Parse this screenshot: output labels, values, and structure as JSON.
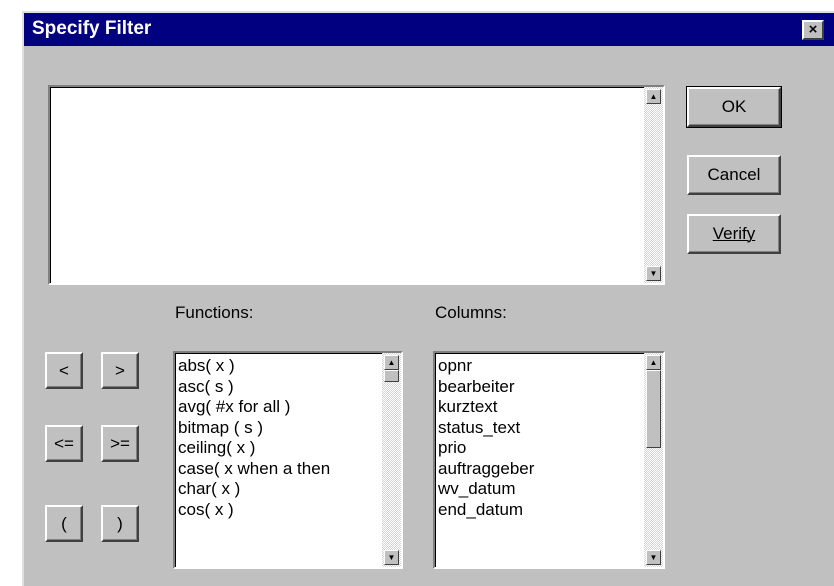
{
  "dialog": {
    "title": "Specify Filter",
    "close_label": "×"
  },
  "expression": {
    "value": ""
  },
  "buttons": {
    "ok": "OK",
    "cancel": "Cancel",
    "verify": "Verify"
  },
  "operators": [
    "<",
    ">",
    "<=",
    ">=",
    "(",
    ")"
  ],
  "functions": {
    "label": "Functions:",
    "items": [
      "abs( x )",
      "asc( s )",
      "avg( #x for all )",
      "bitmap ( s )",
      "ceiling( x )",
      "case( x when a then",
      "char( x )",
      "cos( x )"
    ]
  },
  "columns": {
    "label": "Columns:",
    "items": [
      "opnr",
      "bearbeiter",
      "kurztext",
      "status_text",
      "prio",
      "auftraggeber",
      "wv_datum",
      "end_datum"
    ]
  },
  "scroll_arrows": {
    "up": "▲",
    "down": "▼"
  }
}
